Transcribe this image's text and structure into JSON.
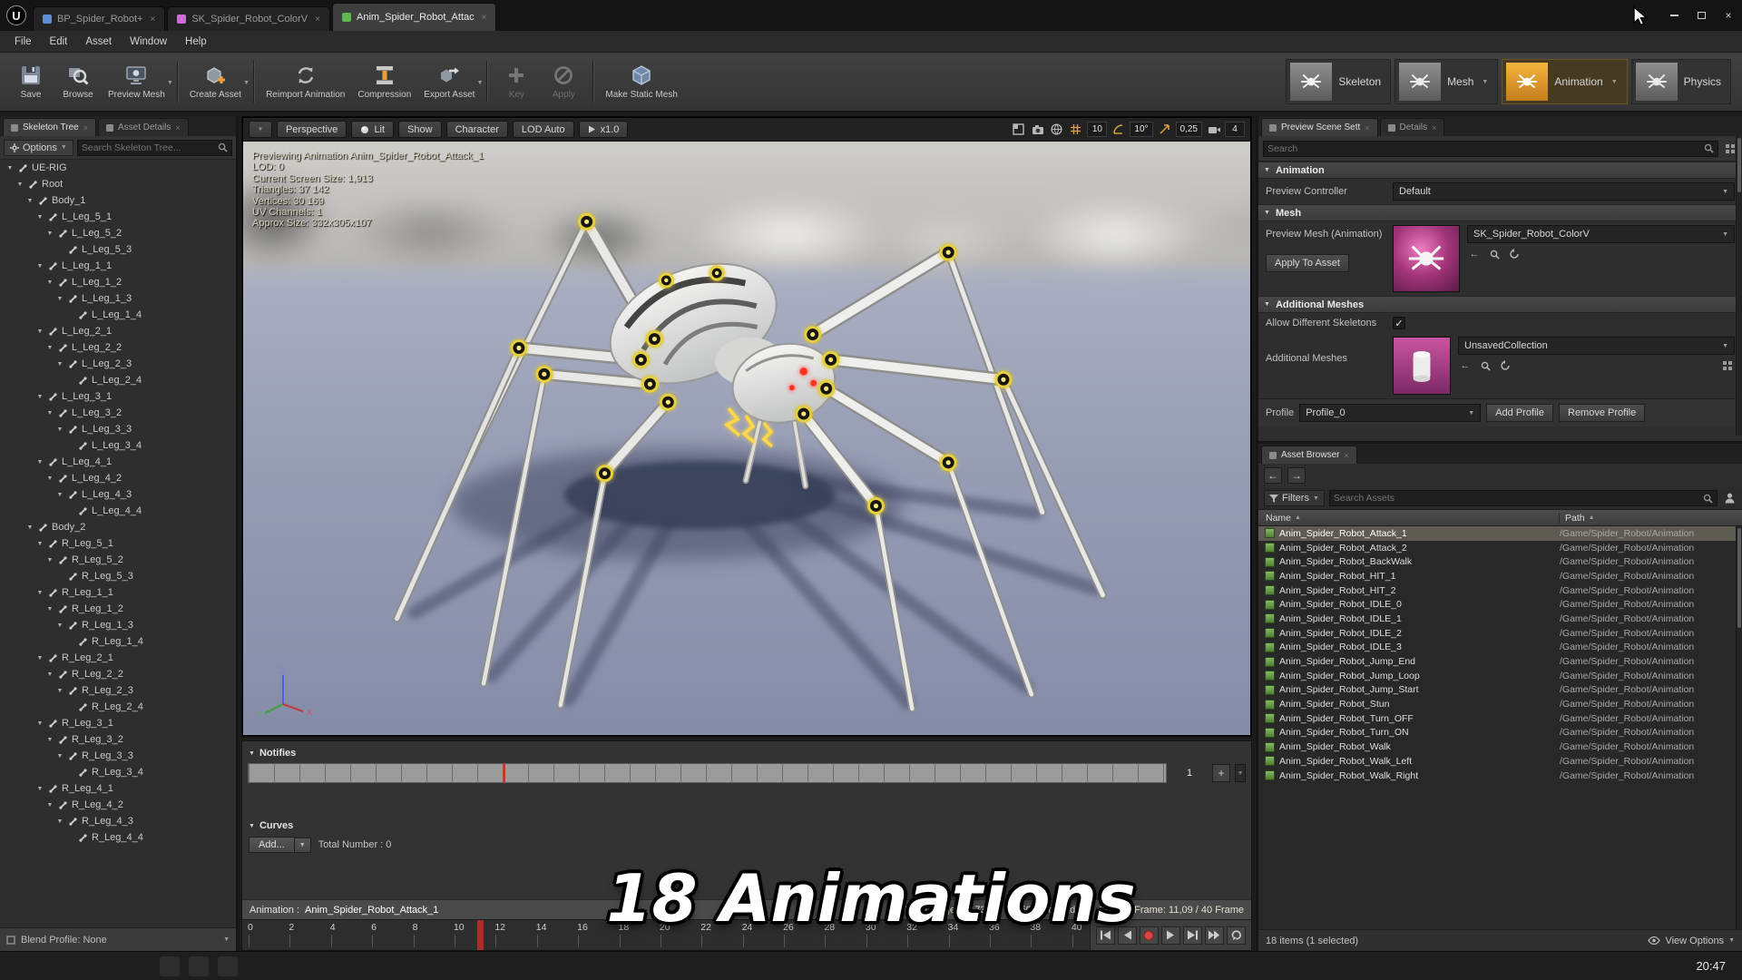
{
  "colors": {
    "accent_orange": "#e8a33d",
    "record_red": "#d84343",
    "selection_grey": "#5d5b52",
    "anim_green": "#63b54f",
    "mesh_pink": "#cf6bd6",
    "blueprint_blue": "#5f8fd0"
  },
  "overlay": {
    "title": "18 Animations"
  },
  "taskbar": {
    "time": "20:47"
  },
  "window_tabs": [
    {
      "label": "BP_Spider_Robot+",
      "icon_color": "#5f8fd0",
      "active": false
    },
    {
      "label": "SK_Spider_Robot_ColorV",
      "icon_color": "#cf6bd6",
      "active": false
    },
    {
      "label": "Anim_Spider_Robot_Attac",
      "icon_color": "#63b54f",
      "active": true
    }
  ],
  "menu": [
    {
      "label": "File"
    },
    {
      "label": "Edit"
    },
    {
      "label": "Asset"
    },
    {
      "label": "Window"
    },
    {
      "label": "Help"
    }
  ],
  "toolbar": [
    {
      "label": "Save",
      "icon": "save-icon"
    },
    {
      "label": "Browse",
      "icon": "browse-icon"
    },
    {
      "label": "Preview Mesh",
      "icon": "preview-mesh-icon",
      "dropdown": true
    },
    {
      "label": "Create Asset",
      "icon": "create-asset-icon",
      "dropdown": true
    },
    {
      "label": "Reimport Animation",
      "icon": "reimport-animation-icon"
    },
    {
      "label": "Compression",
      "icon": "compression-icon"
    },
    {
      "label": "Export Asset",
      "icon": "export-asset-icon",
      "dropdown": true
    },
    {
      "label": "Key",
      "icon": "key-icon",
      "disabled": true
    },
    {
      "label": "Apply",
      "icon": "apply-icon",
      "disabled": true
    },
    {
      "label": "Make Static Mesh",
      "icon": "make-static-mesh-icon"
    }
  ],
  "modes": [
    {
      "label": "Skeleton",
      "active": false
    },
    {
      "label": "Mesh",
      "active": false,
      "dropdown": true
    },
    {
      "label": "Animation",
      "active": true,
      "dropdown": true
    },
    {
      "label": "Physics",
      "active": false
    }
  ],
  "skeleton_panel": {
    "tabs": [
      {
        "label": "Skeleton Tree",
        "active": true
      },
      {
        "label": "Asset Details",
        "active": false
      }
    ],
    "options_label": "Options",
    "search_placeholder": "Search Skeleton Tree...",
    "blend_profile_label": "Blend Profile: None",
    "bones": [
      {
        "label": "UE-RIG",
        "indent": 0,
        "arrow": "▼"
      },
      {
        "label": "Root",
        "indent": 1,
        "arrow": "▼"
      },
      {
        "label": "Body_1",
        "indent": 2,
        "arrow": "▼"
      },
      {
        "label": "L_Leg_5_1",
        "indent": 3,
        "arrow": "▼"
      },
      {
        "label": "L_Leg_5_2",
        "indent": 4,
        "arrow": "▼"
      },
      {
        "label": "L_Leg_5_3",
        "indent": 5,
        "arrow": ""
      },
      {
        "label": "L_Leg_1_1",
        "indent": 3,
        "arrow": "▼"
      },
      {
        "label": "L_Leg_1_2",
        "indent": 4,
        "arrow": "▼"
      },
      {
        "label": "L_Leg_1_3",
        "indent": 5,
        "arrow": "▼"
      },
      {
        "label": "L_Leg_1_4",
        "indent": 6,
        "arrow": ""
      },
      {
        "label": "L_Leg_2_1",
        "indent": 3,
        "arrow": "▼"
      },
      {
        "label": "L_Leg_2_2",
        "indent": 4,
        "arrow": "▼"
      },
      {
        "label": "L_Leg_2_3",
        "indent": 5,
        "arrow": "▼"
      },
      {
        "label": "L_Leg_2_4",
        "indent": 6,
        "arrow": ""
      },
      {
        "label": "L_Leg_3_1",
        "indent": 3,
        "arrow": "▼"
      },
      {
        "label": "L_Leg_3_2",
        "indent": 4,
        "arrow": "▼"
      },
      {
        "label": "L_Leg_3_3",
        "indent": 5,
        "arrow": "▼"
      },
      {
        "label": "L_Leg_3_4",
        "indent": 6,
        "arrow": ""
      },
      {
        "label": "L_Leg_4_1",
        "indent": 3,
        "arrow": "▼"
      },
      {
        "label": "L_Leg_4_2",
        "indent": 4,
        "arrow": "▼"
      },
      {
        "label": "L_Leg_4_3",
        "indent": 5,
        "arrow": "▼"
      },
      {
        "label": "L_Leg_4_4",
        "indent": 6,
        "arrow": ""
      },
      {
        "label": "Body_2",
        "indent": 2,
        "arrow": "▼"
      },
      {
        "label": "R_Leg_5_1",
        "indent": 3,
        "arrow": "▼"
      },
      {
        "label": "R_Leg_5_2",
        "indent": 4,
        "arrow": "▼"
      },
      {
        "label": "R_Leg_5_3",
        "indent": 5,
        "arrow": ""
      },
      {
        "label": "R_Leg_1_1",
        "indent": 3,
        "arrow": "▼"
      },
      {
        "label": "R_Leg_1_2",
        "indent": 4,
        "arrow": "▼"
      },
      {
        "label": "R_Leg_1_3",
        "indent": 5,
        "arrow": "▼"
      },
      {
        "label": "R_Leg_1_4",
        "indent": 6,
        "arrow": ""
      },
      {
        "label": "R_Leg_2_1",
        "indent": 3,
        "arrow": "▼"
      },
      {
        "label": "R_Leg_2_2",
        "indent": 4,
        "arrow": "▼"
      },
      {
        "label": "R_Leg_2_3",
        "indent": 5,
        "arrow": "▼"
      },
      {
        "label": "R_Leg_2_4",
        "indent": 6,
        "arrow": ""
      },
      {
        "label": "R_Leg_3_1",
        "indent": 3,
        "arrow": "▼"
      },
      {
        "label": "R_Leg_3_2",
        "indent": 4,
        "arrow": "▼"
      },
      {
        "label": "R_Leg_3_3",
        "indent": 5,
        "arrow": "▼"
      },
      {
        "label": "R_Leg_3_4",
        "indent": 6,
        "arrow": ""
      },
      {
        "label": "R_Leg_4_1",
        "indent": 3,
        "arrow": "▼"
      },
      {
        "label": "R_Leg_4_2",
        "indent": 4,
        "arrow": "▼"
      },
      {
        "label": "R_Leg_4_3",
        "indent": 5,
        "arrow": "▼"
      },
      {
        "label": "R_Leg_4_4",
        "indent": 6,
        "arrow": ""
      }
    ]
  },
  "viewport": {
    "toolbar": {
      "camera": "Perspective",
      "lit": "Lit",
      "show": "Show",
      "character": "Character",
      "lod": "LOD Auto",
      "speed": "x1.0"
    },
    "stats": [
      "Previewing Animation Anim_Spider_Robot_Attack_1",
      "LOD: 0",
      "Current Screen Size: 1,913",
      "Triangles: 37 142",
      "Vertices: 30 169",
      "UV Channels: 1",
      "Approx Size: 332x305x107"
    ],
    "snaps": {
      "grid": "10",
      "angle": "10°",
      "scale": "0,25",
      "camera": "4"
    },
    "gizmo": {
      "x": "X",
      "y": "Y",
      "z": "Z"
    }
  },
  "timeline": {
    "notifies_label": "Notifies",
    "track_lane": "1",
    "curves_label": "Curves",
    "add_button": "Add...",
    "total_label": "Total Number : 0",
    "animation_label": "Animation :",
    "animation_name": "Anim_Spider_Robot_Attack_1",
    "percentage": "Percentage: 27,73 %",
    "current_time": "1,500 (seconds)",
    "current_frame": "Current Frame: 11,09 / 40 Frame",
    "playhead_frac": 0.277,
    "ticks": [
      "0",
      "2",
      "4",
      "6",
      "8",
      "10",
      "12",
      "14",
      "16",
      "18",
      "20",
      "22",
      "24",
      "26",
      "28",
      "30",
      "32",
      "34",
      "36",
      "38",
      "40"
    ]
  },
  "preview_panel": {
    "tabs": [
      {
        "label": "Preview Scene Sett",
        "active": true
      },
      {
        "label": "Details",
        "active": false
      }
    ],
    "search_placeholder": "Search",
    "section_animation": "Animation",
    "section_mesh": "Mesh",
    "section_additional": "Additional Meshes",
    "preview_controller_label": "Preview Controller",
    "preview_controller_value": "Default",
    "preview_mesh_label": "Preview Mesh (Animation)",
    "preview_mesh_value": "SK_Spider_Robot_ColorV",
    "apply_button": "Apply To Asset",
    "allow_skeletons_label": "Allow Different Skeletons",
    "additional_meshes_label": "Additional Meshes",
    "additional_meshes_value": "UnsavedCollection",
    "profile_label": "Profile",
    "profile_value": "Profile_0",
    "add_profile_button": "Add Profile",
    "remove_profile_button": "Remove Profile"
  },
  "asset_browser": {
    "tab": "Asset Browser",
    "filters_label": "Filters",
    "search_placeholder": "Search Assets",
    "col_name": "Name",
    "col_path": "Path",
    "rows": [
      {
        "name": "Anim_Spider_Robot_Attack_1",
        "path": "/Game/Spider_Robot/Animation",
        "selected": true
      },
      {
        "name": "Anim_Spider_Robot_Attack_2",
        "path": "/Game/Spider_Robot/Animation"
      },
      {
        "name": "Anim_Spider_Robot_BackWalk",
        "path": "/Game/Spider_Robot/Animation"
      },
      {
        "name": "Anim_Spider_Robot_HIT_1",
        "path": "/Game/Spider_Robot/Animation"
      },
      {
        "name": "Anim_Spider_Robot_HIT_2",
        "path": "/Game/Spider_Robot/Animation"
      },
      {
        "name": "Anim_Spider_Robot_IDLE_0",
        "path": "/Game/Spider_Robot/Animation"
      },
      {
        "name": "Anim_Spider_Robot_IDLE_1",
        "path": "/Game/Spider_Robot/Animation"
      },
      {
        "name": "Anim_Spider_Robot_IDLE_2",
        "path": "/Game/Spider_Robot/Animation"
      },
      {
        "name": "Anim_Spider_Robot_IDLE_3",
        "path": "/Game/Spider_Robot/Animation"
      },
      {
        "name": "Anim_Spider_Robot_Jump_End",
        "path": "/Game/Spider_Robot/Animation"
      },
      {
        "name": "Anim_Spider_Robot_Jump_Loop",
        "path": "/Game/Spider_Robot/Animation"
      },
      {
        "name": "Anim_Spider_Robot_Jump_Start",
        "path": "/Game/Spider_Robot/Animation"
      },
      {
        "name": "Anim_Spider_Robot_Stun",
        "path": "/Game/Spider_Robot/Animation"
      },
      {
        "name": "Anim_Spider_Robot_Turn_OFF",
        "path": "/Game/Spider_Robot/Animation"
      },
      {
        "name": "Anim_Spider_Robot_Turn_ON",
        "path": "/Game/Spider_Robot/Animation"
      },
      {
        "name": "Anim_Spider_Robot_Walk",
        "path": "/Game/Spider_Robot/Animation"
      },
      {
        "name": "Anim_Spider_Robot_Walk_Left",
        "path": "/Game/Spider_Robot/Animation"
      },
      {
        "name": "Anim_Spider_Robot_Walk_Right",
        "path": "/Game/Spider_Robot/Animation"
      }
    ],
    "footer_left": "18 items (1 selected)",
    "view_options_label": "View Options"
  }
}
